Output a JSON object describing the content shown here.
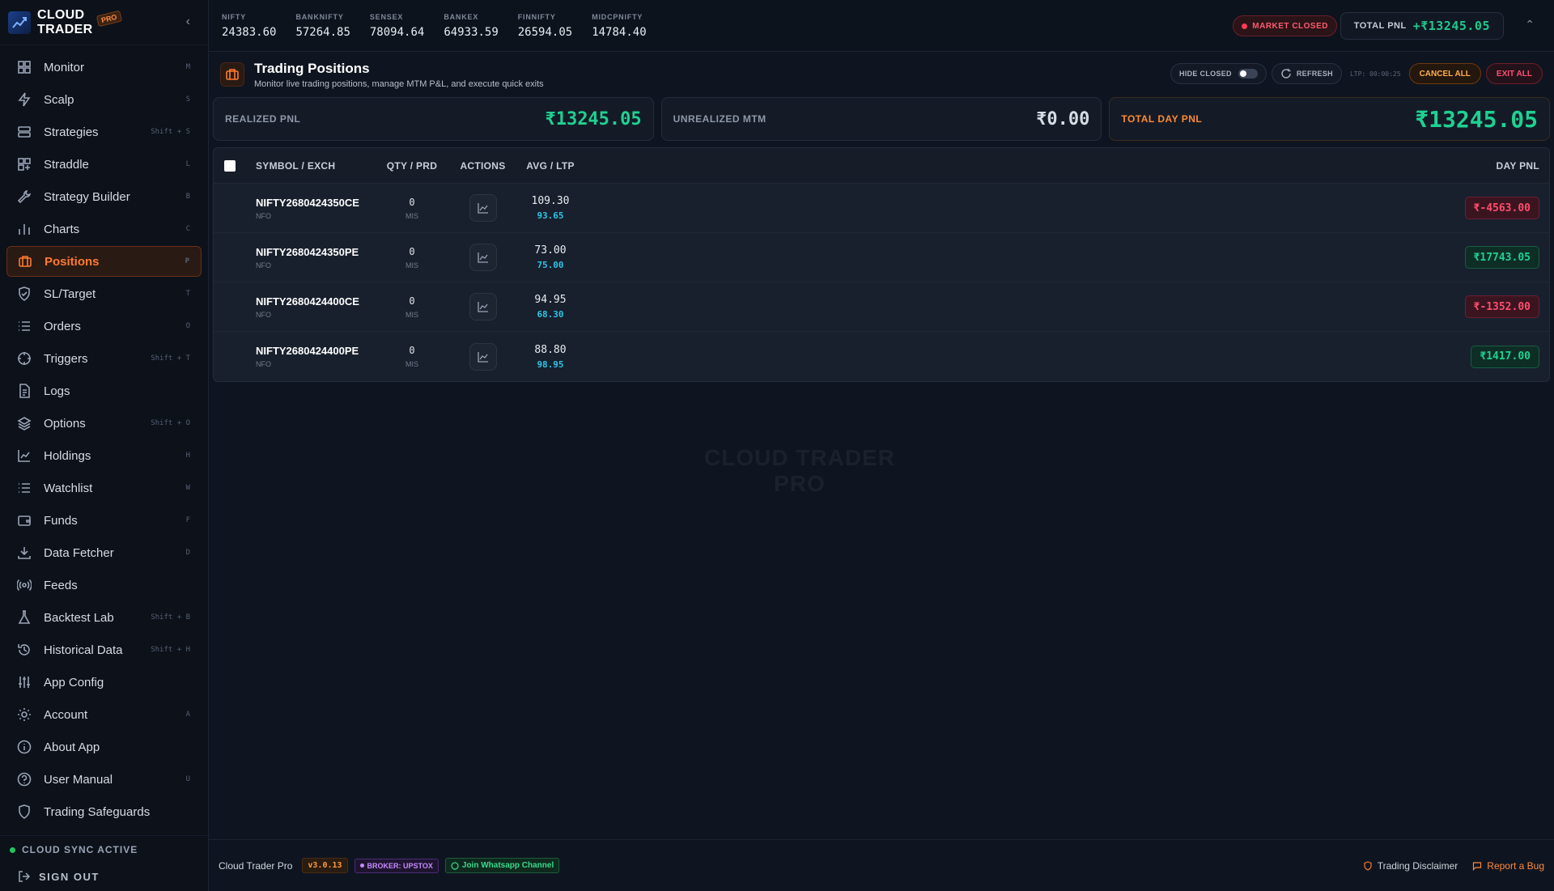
{
  "brand": {
    "line1": "CLOUD",
    "line2": "TRADER",
    "badge": "PRO"
  },
  "nav": [
    {
      "label": "Monitor",
      "shortcut": "M",
      "icon": "grid-icon"
    },
    {
      "label": "Scalp",
      "shortcut": "S",
      "icon": "bolt-icon"
    },
    {
      "label": "Strategies",
      "shortcut": "Shift + S",
      "icon": "layers-icon"
    },
    {
      "label": "Straddle",
      "shortcut": "L",
      "icon": "straddle-icon"
    },
    {
      "label": "Strategy Builder",
      "shortcut": "B",
      "icon": "wrench-icon"
    },
    {
      "label": "Charts",
      "shortcut": "C",
      "icon": "bar-chart-icon"
    },
    {
      "label": "Positions",
      "shortcut": "P",
      "icon": "briefcase-icon",
      "active": true
    },
    {
      "label": "SL/Target",
      "shortcut": "T",
      "icon": "shield-check-icon"
    },
    {
      "label": "Orders",
      "shortcut": "O",
      "icon": "list-icon"
    },
    {
      "label": "Triggers",
      "shortcut": "Shift + T",
      "icon": "crosshair-icon"
    },
    {
      "label": "Logs",
      "shortcut": "",
      "icon": "document-icon"
    },
    {
      "label": "Options",
      "shortcut": "Shift + O",
      "icon": "stack-icon"
    },
    {
      "label": "Holdings",
      "shortcut": "H",
      "icon": "line-chart-icon"
    },
    {
      "label": "Watchlist",
      "shortcut": "W",
      "icon": "list-icon"
    },
    {
      "label": "Funds",
      "shortcut": "F",
      "icon": "wallet-icon"
    },
    {
      "label": "Data Fetcher",
      "shortcut": "D",
      "icon": "download-icon"
    },
    {
      "label": "Feeds",
      "shortcut": "",
      "icon": "broadcast-icon"
    },
    {
      "label": "Backtest Lab",
      "shortcut": "Shift + B",
      "icon": "flask-icon"
    },
    {
      "label": "Historical Data",
      "shortcut": "Shift + H",
      "icon": "history-icon"
    },
    {
      "label": "App Config",
      "shortcut": "",
      "icon": "sliders-icon"
    },
    {
      "label": "Account",
      "shortcut": "A",
      "icon": "gear-icon"
    },
    {
      "label": "About App",
      "shortcut": "",
      "icon": "info-icon"
    },
    {
      "label": "User Manual",
      "shortcut": "U",
      "icon": "help-icon"
    },
    {
      "label": "Trading Safeguards",
      "shortcut": "",
      "icon": "shield-icon"
    }
  ],
  "sidebar_footer": {
    "sync": "CLOUD SYNC ACTIVE",
    "signout": "SIGN OUT",
    "sync_color": "#22c55e"
  },
  "ticker": [
    {
      "name": "NIFTY",
      "value": "24383.60"
    },
    {
      "name": "BANKNIFTY",
      "value": "57264.85"
    },
    {
      "name": "SENSEX",
      "value": "78094.64"
    },
    {
      "name": "BANKEX",
      "value": "64933.59"
    },
    {
      "name": "FINNIFTY",
      "value": "26594.05"
    },
    {
      "name": "MIDCPNIFTY",
      "value": "14784.40"
    }
  ],
  "market_status": "MARKET CLOSED",
  "total_pnl": {
    "label": "TOTAL PNL",
    "value": "+₹13245.05"
  },
  "page": {
    "title": "Trading Positions",
    "subtitle": "Monitor live trading positions, manage MTM P&L, and execute quick exits",
    "hide_closed": "HIDE CLOSED",
    "refresh": "REFRESH",
    "ltp_time": "LTP: 00:00:25",
    "cancel_all": "CANCEL ALL",
    "exit_all": "EXIT ALL"
  },
  "cards": {
    "realized": {
      "label": "REALIZED PNL",
      "value": "₹13245.05"
    },
    "unrealized": {
      "label": "UNREALIZED MTM",
      "value": "₹0.00"
    },
    "total": {
      "label": "TOTAL DAY PNL",
      "value": "₹13245.05"
    }
  },
  "table": {
    "headers": {
      "symbol": "SYMBOL / EXCH",
      "qty": "QTY / PRD",
      "actions": "ACTIONS",
      "avg": "AVG / LTP",
      "pnl": "DAY PNL"
    },
    "rows": [
      {
        "symbol": "NIFTY2680424350CE",
        "exch": "NFO",
        "qty": "0",
        "prd": "MIS",
        "avg": "109.30",
        "ltp": "93.65",
        "pnl": "₹-4563.00",
        "positive": false
      },
      {
        "symbol": "NIFTY2680424350PE",
        "exch": "NFO",
        "qty": "0",
        "prd": "MIS",
        "avg": "73.00",
        "ltp": "75.00",
        "pnl": "₹17743.05",
        "positive": true
      },
      {
        "symbol": "NIFTY2680424400CE",
        "exch": "NFO",
        "qty": "0",
        "prd": "MIS",
        "avg": "94.95",
        "ltp": "68.30",
        "pnl": "₹-1352.00",
        "positive": false
      },
      {
        "symbol": "NIFTY2680424400PE",
        "exch": "NFO",
        "qty": "0",
        "prd": "MIS",
        "avg": "88.80",
        "ltp": "98.95",
        "pnl": "₹1417.00",
        "positive": true
      }
    ]
  },
  "watermark": {
    "line1": "CLOUD TRADER",
    "line2": "PRO"
  },
  "footer": {
    "app": "Cloud Trader Pro",
    "version": "v3.0.13",
    "broker": "BROKER: UPSTOX",
    "whatsapp": "Join Whatsapp Channel",
    "disclaimer": "Trading Disclaimer",
    "report": "Report a Bug"
  },
  "colors": {
    "accent": "#ff7a2f",
    "positive": "#1fd191",
    "negative": "#ff4d6d",
    "ltp": "#2ec4e6"
  }
}
